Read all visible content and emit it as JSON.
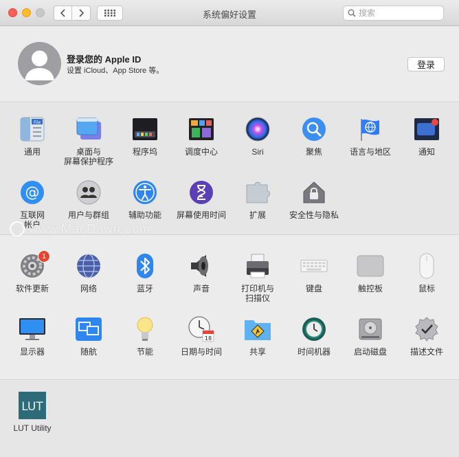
{
  "window": {
    "title": "系统偏好设置"
  },
  "search": {
    "placeholder": "搜索"
  },
  "account": {
    "title": "登录您的 Apple ID",
    "subtitle": "设置 iCloud、App Store 等。",
    "login_label": "登录"
  },
  "section1": [
    {
      "label": "通用",
      "icon": "general-icon"
    },
    {
      "label": "桌面与\n屏幕保护程序",
      "icon": "desktop-icon"
    },
    {
      "label": "程序坞",
      "icon": "dock-icon"
    },
    {
      "label": "调度中心",
      "icon": "mission-control-icon"
    },
    {
      "label": "Siri",
      "icon": "siri-icon"
    },
    {
      "label": "聚焦",
      "icon": "spotlight-icon"
    },
    {
      "label": "语言与地区",
      "icon": "language-region-icon"
    },
    {
      "label": "通知",
      "icon": "notifications-icon"
    },
    {
      "label": "互联网\n帐户",
      "icon": "internet-accounts-icon"
    },
    {
      "label": "用户与群组",
      "icon": "users-groups-icon"
    },
    {
      "label": "辅助功能",
      "icon": "accessibility-icon"
    },
    {
      "label": "屏幕使用时间",
      "icon": "screen-time-icon"
    },
    {
      "label": "扩展",
      "icon": "extensions-icon"
    },
    {
      "label": "安全性与隐私",
      "icon": "security-privacy-icon"
    }
  ],
  "section2": [
    {
      "label": "软件更新",
      "icon": "software-update-icon",
      "badge": "1"
    },
    {
      "label": "网络",
      "icon": "network-icon"
    },
    {
      "label": "蓝牙",
      "icon": "bluetooth-icon"
    },
    {
      "label": "声音",
      "icon": "sound-icon"
    },
    {
      "label": "打印机与\n扫描仪",
      "icon": "printer-icon"
    },
    {
      "label": "键盘",
      "icon": "keyboard-icon"
    },
    {
      "label": "触控板",
      "icon": "trackpad-icon"
    },
    {
      "label": "鼠标",
      "icon": "mouse-icon"
    },
    {
      "label": "显示器",
      "icon": "displays-icon"
    },
    {
      "label": "随航",
      "icon": "sidecar-icon"
    },
    {
      "label": "节能",
      "icon": "energy-saver-icon"
    },
    {
      "label": "日期与时间",
      "icon": "date-time-icon"
    },
    {
      "label": "共享",
      "icon": "sharing-icon"
    },
    {
      "label": "时间机器",
      "icon": "time-machine-icon"
    },
    {
      "label": "启动磁盘",
      "icon": "startup-disk-icon"
    },
    {
      "label": "描述文件",
      "icon": "profiles-icon"
    }
  ],
  "section3": [
    {
      "label": "LUT Utility",
      "icon": "lut-utility-icon",
      "icon_text": "LUT"
    }
  ],
  "watermark": "www.MacDown.com",
  "colors": {
    "accent": "#2f7cf6",
    "badge": "#e7432f"
  }
}
